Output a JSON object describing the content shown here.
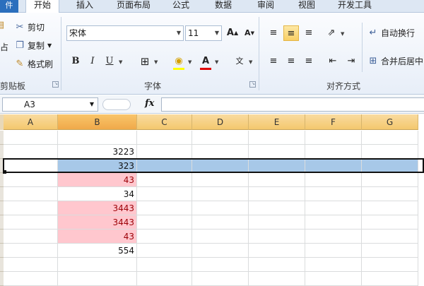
{
  "tabs": {
    "file": "件",
    "items": [
      "开始",
      "插入",
      "页面布局",
      "公式",
      "数据",
      "审阅",
      "视图",
      "开发工具"
    ]
  },
  "clipboard": {
    "paste_fragment": "占",
    "cut": "剪切",
    "copy": "复制",
    "format_painter": "格式刷",
    "label": "剪贴板"
  },
  "font": {
    "name": "宋体",
    "size": "11",
    "bold": "B",
    "italic": "I",
    "underline": "U",
    "label": "字体"
  },
  "alignment": {
    "wrap_text": "自动换行",
    "merge_center": "合并后居中",
    "label": "对齐方式"
  },
  "formula_bar": {
    "name_box": "A3",
    "fx": "fx"
  },
  "columns": [
    "A",
    "B",
    "C",
    "D",
    "E",
    "F",
    "G"
  ],
  "selected_column": "B",
  "cells": [
    {
      "row": 2,
      "value": "3223",
      "style": "plain"
    },
    {
      "row": 3,
      "value": "323",
      "style": "blue"
    },
    {
      "row": 4,
      "value": "43",
      "style": "pink"
    },
    {
      "row": 5,
      "value": "34",
      "style": "plain"
    },
    {
      "row": 6,
      "value": "3443",
      "style": "pink"
    },
    {
      "row": 7,
      "value": "3443",
      "style": "pink"
    },
    {
      "row": 8,
      "value": "43",
      "style": "pink"
    },
    {
      "row": 9,
      "value": "554",
      "style": "plain"
    }
  ],
  "colors": {
    "duplicate_fill": "#ffc7ce",
    "duplicate_text": "#9c0006",
    "selection_fill": "#a7c8e8",
    "file_tab": "#2b6fbd"
  }
}
